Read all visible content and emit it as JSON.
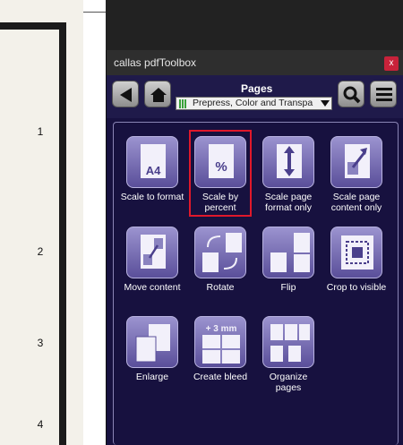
{
  "document": {
    "line_numbers": [
      "1",
      "2",
      "3",
      "4"
    ]
  },
  "panel": {
    "title": "callas pdfToolbox",
    "close_label": "x",
    "toolbar": {
      "section_title": "Pages",
      "profile_dropdown_value": "Prepress, Color and Transpa"
    },
    "tools": [
      {
        "label": "Scale to format",
        "icon": "a4-page-icon"
      },
      {
        "label": "Scale by percent",
        "icon": "percent-page-icon",
        "selected": true
      },
      {
        "label": "Scale page format only",
        "icon": "page-arrows-vertical-icon"
      },
      {
        "label": "Scale page content only",
        "icon": "page-arrow-diagonal-icon"
      },
      {
        "label": "Move content",
        "icon": "move-content-icon"
      },
      {
        "label": "Rotate",
        "icon": "rotate-icon"
      },
      {
        "label": "Flip",
        "icon": "flip-icon"
      },
      {
        "label": "Crop to visible",
        "icon": "crop-icon"
      },
      {
        "label": "Enlarge",
        "icon": "enlarge-icon"
      },
      {
        "label": "Create bleed",
        "icon": "bleed-icon",
        "badge": "+ 3 mm"
      },
      {
        "label": "Organize pages",
        "icon": "organize-pages-icon"
      }
    ]
  }
}
